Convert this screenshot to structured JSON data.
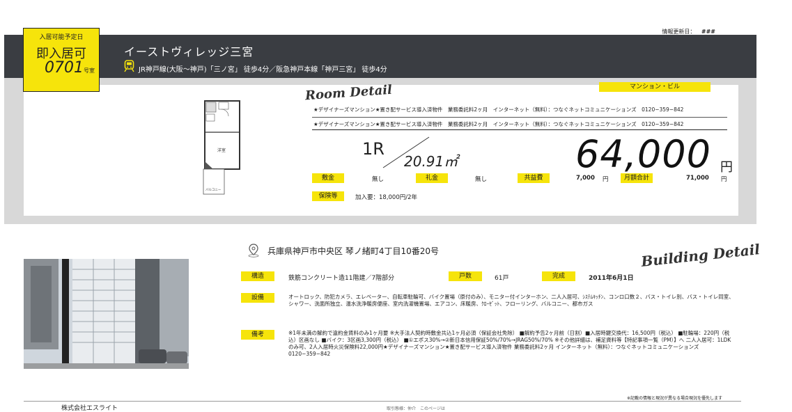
{
  "header": {
    "update_label": "情報更新日：",
    "update_value": "###",
    "title": "イーストヴィレッジ三宮",
    "access": "JR神戸線(大阪〜神戸)「三ノ宮」 徒歩4分／阪急神戸本線「神戸三宮」 徒歩4分"
  },
  "badge": {
    "top_label": "入居可能予定日",
    "status": "即入居可",
    "room_number": "0701",
    "room_suffix": "号室"
  },
  "room_detail": {
    "section_label": "Room Detail",
    "property_type": "マンション・ビル",
    "note_1": "★デザイナーズマンション★置き配サービス導入済物件　業務委託料2ヶ月　インターネット（無料）：つなぐネットコミュニケーションズ　0120−359−842",
    "note_2": "★デザイナーズマンション★置き配サービス導入済物件　業務委託料2ヶ月　インターネット（無料）：つなぐネットコミュニケーションズ　0120−359−842",
    "layout": "1R",
    "area": "20.91㎡",
    "rent": "64,000",
    "rent_unit": "円",
    "fees": {
      "deposit_label": "敷金",
      "deposit_value": "無し",
      "key_money_label": "礼金",
      "key_money_value": "無し",
      "common_fee_label": "共益費",
      "common_fee_value": "7,000",
      "common_fee_unit": "円",
      "monthly_total_label": "月額合計",
      "monthly_total_value": "71,000",
      "monthly_total_unit": "円",
      "insurance_label": "保険等",
      "insurance_value": "加入要：18,000円/2年"
    },
    "floorplan_labels": {
      "room": "洋室",
      "balcony": "バルコニー"
    }
  },
  "building_detail": {
    "section_label": "Building Detail",
    "address": "兵庫県神戸市中央区 琴ノ緒町4丁目10番20号",
    "structure_label": "構造",
    "structure_value": "鉄筋コンクリート造11階建／7階部分",
    "units_label": "戸数",
    "units_value": "61戸",
    "completed_label": "完成",
    "completed_value": "2011年6月1日",
    "facilities_label": "設備",
    "facilities_value": "オートロック、防犯カメラ、エレベーター、自転車駐輪可、バイク置場（原付のみ）、モニター付インターホン、二人入居可、ｼｽﾃﾑｷｯﾁﾝ、コンロ口数２、バス・トイレ別、バス・トイレ同室、シャワー、洗面所独立、温水洗浄暖房便座、室内洗濯機置場、エアコン、床暖房、ｸﾛｰｾﾞｯﾄ、フローリング、バルコニー、都市ガス",
    "remarks_label": "備考",
    "remarks_value": "※1年未満の解約で違約金賃料のみ1ヶ月要 ※大手法人契約時敷金共込1ヶ月必須（保証会社免除） ■解約予告2ヶ月前（日割）■入居時鍵交換代：16,500円（税込） ■駐輪場：220円（税込）区画なし ■バイク：3区画3,300円（税込） ■①エポス30%→②新日本信用保証50%/70%→JRAG50%/70% ※その他詳細は、補足資料等【特記事項一覧（PM）】へ 二人入居可：1LDKのみ可、2人入居時火災保険料22,000円★デザイナーズマンション★置き配サービス導入済物件 業務委託料2ヶ月 インターネット（無料）：つなぐネットコミュニケーションズ 0120−359−842"
  },
  "footer": {
    "disclaimer": "※記載の情報と現況が異なる場合現況を優先します",
    "company": "株式会社エスライト",
    "bottom_note": "取引態様：仲介　このページは"
  },
  "colors": {
    "accent": "#f6e40b",
    "dark_band": "#3a3d42",
    "panel": "#d8d8d8"
  }
}
